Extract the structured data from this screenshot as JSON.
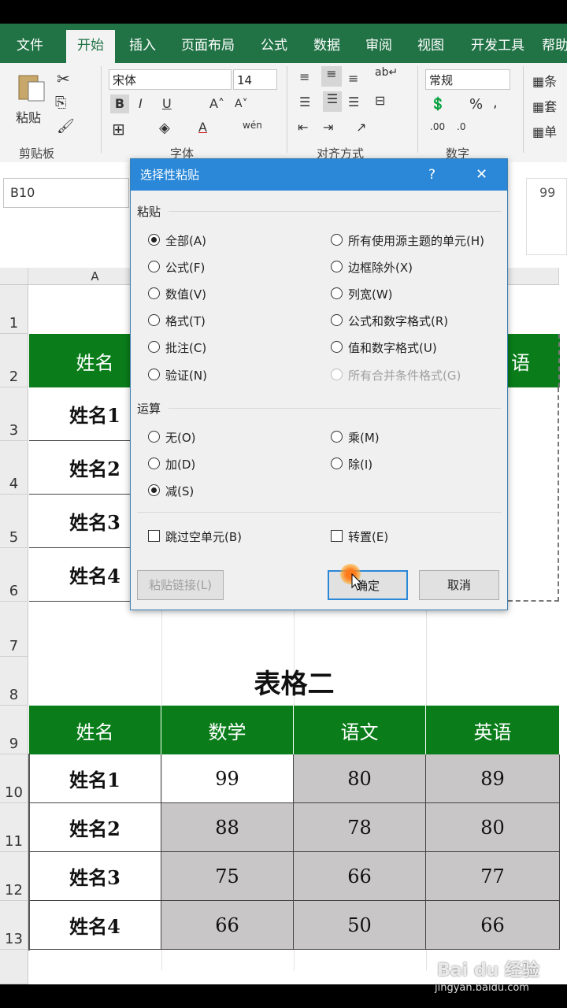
{
  "ribbon": {
    "tabs": [
      "文件",
      "开始",
      "插入",
      "页面布局",
      "公式",
      "数据",
      "审阅",
      "视图",
      "开发工具",
      "帮助"
    ],
    "active_tab": "开始",
    "groups": [
      "剪贴板",
      "字体",
      "对齐方式",
      "数字"
    ],
    "paste_label": "粘贴",
    "font_name": "宋体",
    "font_size": "14",
    "number_format": "常规",
    "right_items": [
      "条",
      "套",
      "单"
    ]
  },
  "formula_bar": {
    "name_box": "B10",
    "value": "99"
  },
  "sheet": {
    "col_a": "A",
    "rows": [
      "1",
      "2",
      "3",
      "4",
      "5",
      "6",
      "7",
      "8",
      "9",
      "10",
      "11",
      "12",
      "13"
    ],
    "table1": {
      "header": "姓名",
      "header_partial": "语",
      "names": [
        "姓名1",
        "姓名2",
        "姓名3",
        "姓名4"
      ]
    },
    "table2": {
      "title": "表格二",
      "headers": [
        "姓名",
        "数学",
        "语文",
        "英语"
      ],
      "rows": [
        [
          "姓名1",
          "99",
          "80",
          "89"
        ],
        [
          "姓名2",
          "88",
          "78",
          "80"
        ],
        [
          "姓名3",
          "75",
          "66",
          "77"
        ],
        [
          "姓名4",
          "66",
          "50",
          "66"
        ]
      ]
    }
  },
  "dialog": {
    "title": "选择性粘贴",
    "help": "?",
    "close": "✕",
    "paste_section": "粘贴",
    "paste_left": [
      "全部(A)",
      "公式(F)",
      "数值(V)",
      "格式(T)",
      "批注(C)",
      "验证(N)"
    ],
    "paste_right": [
      "所有使用源主题的单元(H)",
      "边框除外(X)",
      "列宽(W)",
      "公式和数字格式(R)",
      "值和数字格式(U)",
      "所有合并条件格式(G)"
    ],
    "operation_section": "运算",
    "op_left": [
      "无(O)",
      "加(D)",
      "减(S)"
    ],
    "op_right": [
      "乘(M)",
      "除(I)"
    ],
    "skip_blanks": "跳过空单元(B)",
    "transpose": "转置(E)",
    "paste_link": "粘贴链接(L)",
    "ok": "确定",
    "cancel": "取消"
  },
  "watermark": {
    "text": "Bai du 经验",
    "url": "jingyan.baidu.com"
  }
}
